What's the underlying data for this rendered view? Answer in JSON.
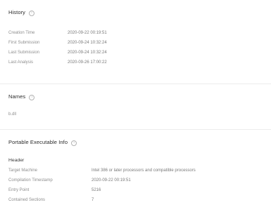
{
  "history": {
    "title": "History",
    "rows": [
      {
        "label": "Creation Time",
        "value": "2020-09-22 00:19:51"
      },
      {
        "label": "First Submission",
        "value": "2020-09-24 10:32:24"
      },
      {
        "label": "Last Submission",
        "value": "2020-09-24 10:32:24"
      },
      {
        "label": "Last Analysis",
        "value": "2020-09-26 17:00:22"
      }
    ]
  },
  "names": {
    "title": "Names",
    "items": [
      "b.dll"
    ]
  },
  "pe": {
    "title": "Portable Executable Info",
    "header_title": "Header",
    "rows": [
      {
        "label": "Target Machine",
        "value": "Intel 386 or later processors and compatible processors"
      },
      {
        "label": "Compilation Timestamp",
        "value": "2020-09-22 00:19:51"
      },
      {
        "label": "Entry Point",
        "value": "5216"
      },
      {
        "label": "Contained Sections",
        "value": "7"
      }
    ]
  },
  "info_icon_glyph": "i"
}
